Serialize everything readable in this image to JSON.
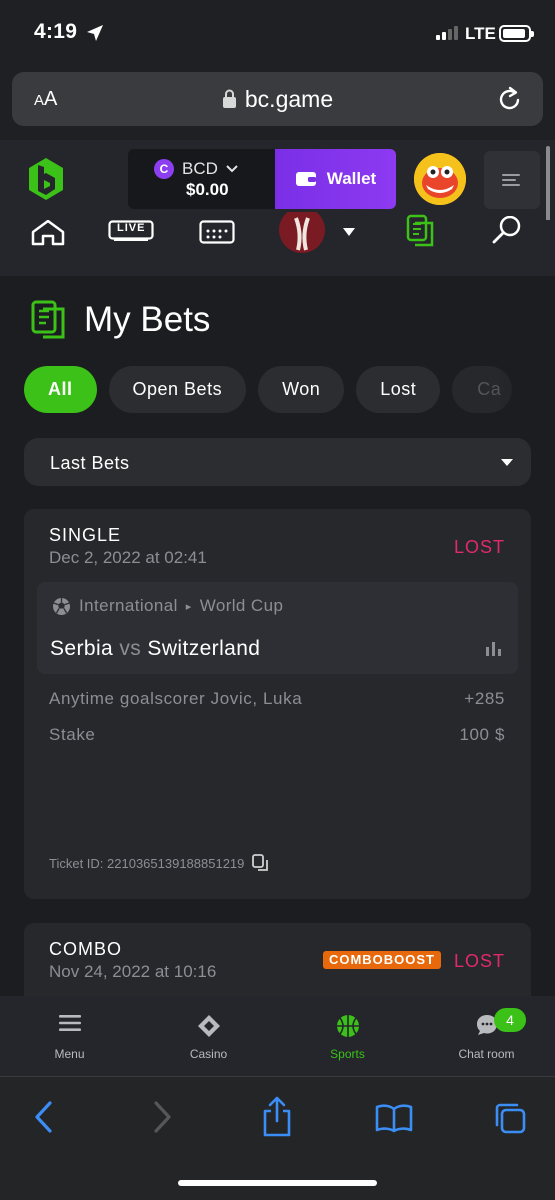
{
  "status_bar": {
    "time": "4:19",
    "network": "LTE"
  },
  "browser": {
    "aa_label": "AA",
    "url": "bc.game"
  },
  "header": {
    "currency": "BCD",
    "coin_symbol": "C",
    "balance": "$0.00",
    "wallet_label": "Wallet"
  },
  "nav": {
    "live_label": "LIVE"
  },
  "page": {
    "title": "My Bets",
    "filters": [
      "All",
      "Open Bets",
      "Won",
      "Lost",
      "Ca"
    ],
    "active_filter": "All",
    "select_value": "Last Bets"
  },
  "bets": [
    {
      "type": "SINGLE",
      "date": "Dec 2, 2022 at 02:41",
      "status": "LOST",
      "league": "International",
      "competition": "World Cup",
      "team_home": "Serbia",
      "vs": "vs",
      "team_away": "Switzerland",
      "market": "Anytime goalscorer Jovic, Luka",
      "odds": "+285",
      "stake_label": "Stake",
      "stake": "100 $",
      "ticket": "Ticket ID: 2210365139188851219"
    },
    {
      "type": "COMBO",
      "date": "Nov 24, 2022 at 10:16",
      "badge": "COMBOBOOST",
      "status": "LOST"
    }
  ],
  "tabbar": {
    "items": [
      "Menu",
      "Casino",
      "Sports",
      "Chat room"
    ],
    "active": "Sports",
    "chat_badge": "4"
  },
  "colors": {
    "accent_green": "#3bc117",
    "wallet_purple": "#7a2fe6",
    "lost_pink": "#e3286b",
    "boost_orange": "#e8680c",
    "ios_blue": "#3b8ef5"
  }
}
